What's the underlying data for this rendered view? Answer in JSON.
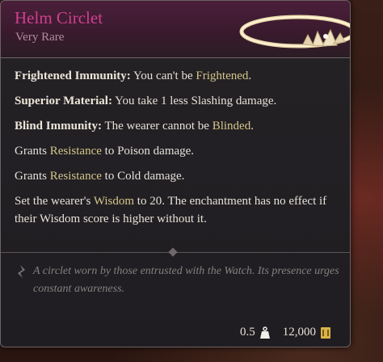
{
  "item": {
    "name": "Helm Circlet",
    "rarity": "Very Rare"
  },
  "properties": [
    {
      "label": "Frightened Immunity:",
      "pre": "You can't be ",
      "hl": "Frightened",
      "post": "."
    },
    {
      "label": "Superior Material:",
      "pre": "You take 1 less Slashing damage.",
      "hl": "",
      "post": ""
    },
    {
      "label": "Blind Immunity:",
      "pre": "The wearer cannot be ",
      "hl": "Blinded",
      "post": "."
    },
    {
      "label": "",
      "pre": "Grants ",
      "hl": "Resistance",
      "post": " to Poison damage."
    },
    {
      "label": "",
      "pre": "Grants ",
      "hl": "Resistance",
      "post": " to Cold damage."
    },
    {
      "label": "",
      "pre": "Set the wearer's ",
      "hl": "Wisdom",
      "post": " to 20. The enchantment has no effect if their Wisdom score is higher without it."
    }
  ],
  "lore": "A circlet worn by those entrusted with the Watch. Its presence urges constant awareness.",
  "footer": {
    "weight": "0.5",
    "value": "12,000",
    "weight_icon": "weight-icon",
    "gold_icon": "gold-icon"
  },
  "colors": {
    "title": "#cf3f8e",
    "rarity": "#b38aa3",
    "highlight": "#d4c68a"
  }
}
